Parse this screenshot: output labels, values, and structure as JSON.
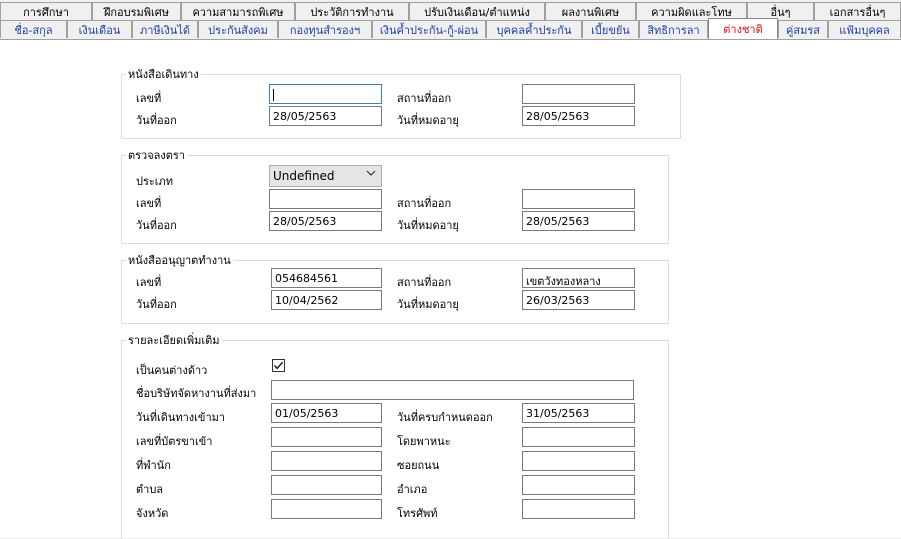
{
  "tabs_row1": [
    "การศึกษา",
    "ฝึกอบรมพิเศษ",
    "ความสามารถพิเศษ",
    "ประวัติการทำงาน",
    "ปรับเงินเดือน/ตำแหน่ง",
    "ผลงานพิเศษ",
    "ความผิดและโทษ",
    "อื่นๆ",
    "เอกสารอื่นๆ"
  ],
  "tabs_row2": [
    "ชื่อ-สกุล",
    "เงินเดือน",
    "ภาษีเงินได้",
    "ประกันสังคม",
    "กองทุนสำรองฯ",
    "เงินค้ำประกัน-กู้-ผ่อน",
    "บุคคลค้ำประกัน",
    "เบี้ยขยัน",
    "สิทธิการลา",
    "ต่างชาติ",
    "คู่สมรส",
    "แฟ้มบุคคล"
  ],
  "active_tab": "ต่างชาติ",
  "colors": {
    "tab_text": "#1a3fa8",
    "active_tab_text": "#e01010"
  },
  "passport": {
    "legend": "หนังสือเดินทาง",
    "number_label": "เลขที่",
    "number_value": "",
    "issue_place_label": "สถานที่ออก",
    "issue_place_value": "",
    "issue_date_label": "วันที่ออก",
    "issue_date_value": "28/05/2563",
    "expiry_label": "วันที่หมดอายุ",
    "expiry_value": "28/05/2563"
  },
  "visa": {
    "legend": "ตรวจลงตรา",
    "type_label": "ประเภท",
    "type_value": "Undefined",
    "number_label": "เลขที่",
    "number_value": "",
    "issue_place_label": "สถานที่ออก",
    "issue_place_value": "",
    "issue_date_label": "วันที่ออก",
    "issue_date_value": "28/05/2563",
    "expiry_label": "วันที่หมดอายุ",
    "expiry_value": "28/05/2563"
  },
  "work_permit": {
    "legend": "หนังสืออนุญาตทำงาน",
    "number_label": "เลขที่",
    "number_value": "054684561",
    "issue_place_label": "สถานที่ออก",
    "issue_place_value": "เขตวังทองหลาง",
    "issue_date_label": "วันที่ออก",
    "issue_date_value": "10/04/2562",
    "expiry_label": "วันที่หมดอายุ",
    "expiry_value": "26/03/2563"
  },
  "extra": {
    "legend": "รายละเอียดเพิ่มเติม",
    "alien_label": "เป็นคนต่างด้าว",
    "alien_checked": true,
    "company_label": "ชื่อบริษัทจัดหางานที่ส่งมา",
    "company_value": "",
    "entry_date_label": "วันที่เดินทางเข้ามา",
    "entry_date_value": "01/05/2563",
    "due_date_label": "วันที่ครบกำหนดออก",
    "due_date_value": "31/05/2563",
    "entry_card_label": "เลขที่บัตรขาเข้า",
    "entry_card_value": "",
    "vehicle_label": "โดยพาหนะ",
    "vehicle_value": "",
    "residence_label": "ที่พำนัก",
    "residence_value": "",
    "soi_label": "ซอยถนน",
    "soi_value": "",
    "subdistrict_label": "ตำบล",
    "subdistrict_value": "",
    "district_label": "อำเภอ",
    "district_value": "",
    "province_label": "จังหวัด",
    "province_value": "",
    "phone_label": "โทรศัพท์",
    "phone_value": ""
  }
}
